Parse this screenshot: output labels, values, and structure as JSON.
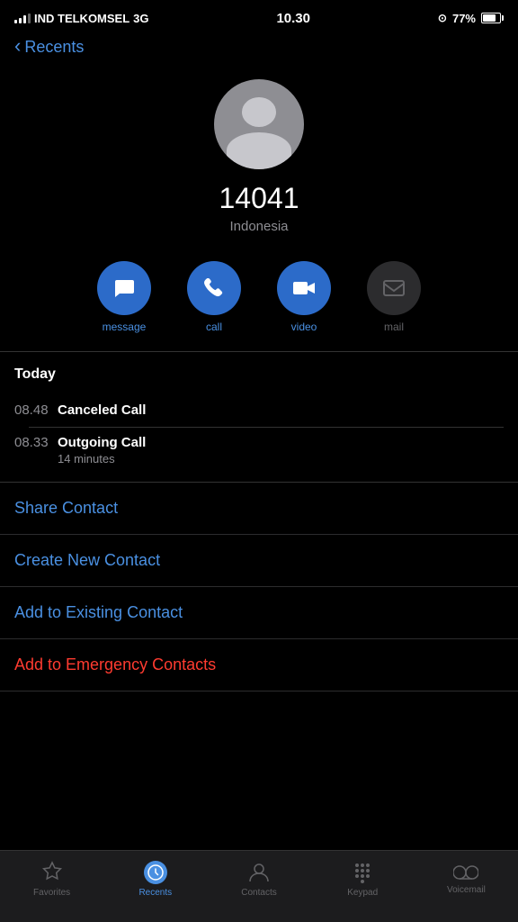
{
  "statusBar": {
    "carrier": "IND TELKOMSEL",
    "network": "3G",
    "time": "10.30",
    "battery": "77%"
  },
  "nav": {
    "backLabel": "Recents"
  },
  "contact": {
    "number": "14041",
    "location": "Indonesia"
  },
  "actions": [
    {
      "id": "message",
      "label": "message",
      "disabled": false
    },
    {
      "id": "call",
      "label": "call",
      "disabled": false
    },
    {
      "id": "video",
      "label": "video",
      "disabled": false
    },
    {
      "id": "mail",
      "label": "mail",
      "disabled": true
    }
  ],
  "callLog": {
    "sectionTitle": "Today",
    "entries": [
      {
        "time": "08.48",
        "type": "Canceled Call",
        "duration": ""
      },
      {
        "time": "08.33",
        "type": "Outgoing Call",
        "duration": "14 minutes"
      }
    ]
  },
  "menu": [
    {
      "id": "share-contact",
      "label": "Share Contact",
      "color": "blue"
    },
    {
      "id": "create-new-contact",
      "label": "Create New Contact",
      "color": "blue"
    },
    {
      "id": "add-existing-contact",
      "label": "Add to Existing Contact",
      "color": "blue"
    },
    {
      "id": "add-emergency-contact",
      "label": "Add to Emergency Contacts",
      "color": "red"
    }
  ],
  "tabBar": {
    "tabs": [
      {
        "id": "favorites",
        "label": "Favorites",
        "active": false
      },
      {
        "id": "recents",
        "label": "Recents",
        "active": true
      },
      {
        "id": "contacts",
        "label": "Contacts",
        "active": false
      },
      {
        "id": "keypad",
        "label": "Keypad",
        "active": false
      },
      {
        "id": "voicemail",
        "label": "Voicemail",
        "active": false
      }
    ]
  }
}
